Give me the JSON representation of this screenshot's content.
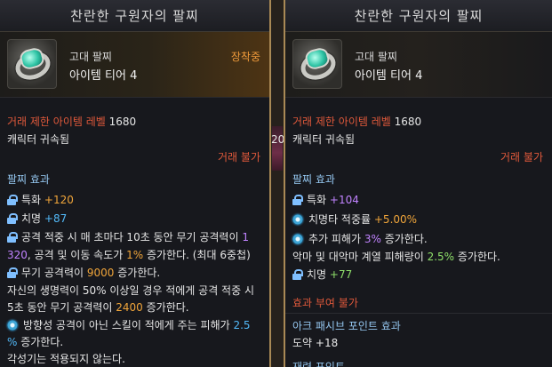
{
  "left": {
    "title": "찬란한 구원자의 팔찌",
    "grade": "고대 팔찌",
    "tier": "아이템 티어 4",
    "equipped": "장착중",
    "trade_level_label": "거래 제한 아이템 레벨",
    "trade_level_value": "1680",
    "bound": "캐릭터 귀속됨",
    "trade_status": "거래 불가",
    "effect_header": "팔찌 효과",
    "lines": [
      {
        "label": "특화 ",
        "value": "+120"
      },
      {
        "label": "치명 ",
        "value": "+87"
      },
      {
        "text1": "공격 적중 시 매 초마다 10초 동안 무기 공격력이 ",
        "value1": "1",
        "text2": "320",
        "text3": ", 공격 및 이동 속도가 ",
        "value2": "1%",
        "text4": " 증가한다. (최대 6중첩)"
      },
      {
        "text1": "무기 공격력이 ",
        "value": "9000",
        "text2": " 증가한다."
      },
      {
        "line1": "자신의 생명력이 50% 이상일 경우 적에게 공격 적중 시",
        "line2a": "5초 동안 무기 공격력이 ",
        "value": "2400",
        "line2b": " 증가한다."
      },
      {
        "text1": "방향성 공격이 아닌 스킬이 적에게 주는 피해가 ",
        "value": "2.5",
        "value_cont": "%",
        "text2": " 증가한다."
      },
      {
        "text": "각성기는 적용되지 않는다."
      }
    ]
  },
  "gap_fragment": "20",
  "right": {
    "title": "찬란한 구원자의 팔찌",
    "grade": "고대 팔찌",
    "tier": "아이템 티어 4",
    "trade_level_label": "거래 제한 아이템 레벨",
    "trade_level_value": "1680",
    "bound": "캐릭터 귀속됨",
    "trade_status": "거래 불가",
    "effect_header": "팔찌 효과",
    "lines": [
      {
        "label": "특화 ",
        "value": "+104"
      },
      {
        "label": "치명타 적중률 ",
        "value": "+5.00%"
      },
      {
        "text1": "추가 피해가 ",
        "value": "3%",
        "text2": " 증가한다."
      },
      {
        "text1": "악마 및 대악마 계열 피해량이 ",
        "value": "2.5%",
        "text2": " 증가한다."
      },
      {
        "label": "치명 ",
        "value": "+77"
      }
    ],
    "apply_header": "효과 부여 불가",
    "ark_header": "아크 패시브 포인트 효과",
    "ark_value": "도약 +18",
    "cut_text": "재련 포인트"
  },
  "colors": {
    "frame": "#a98955",
    "section": "#94c6ef",
    "restricted": "#e0593b",
    "accent_orange": "#f0a53a",
    "accent_purple": "#c183ff",
    "accent_green": "#8fe06a",
    "accent_cyan": "#52b8f7"
  }
}
